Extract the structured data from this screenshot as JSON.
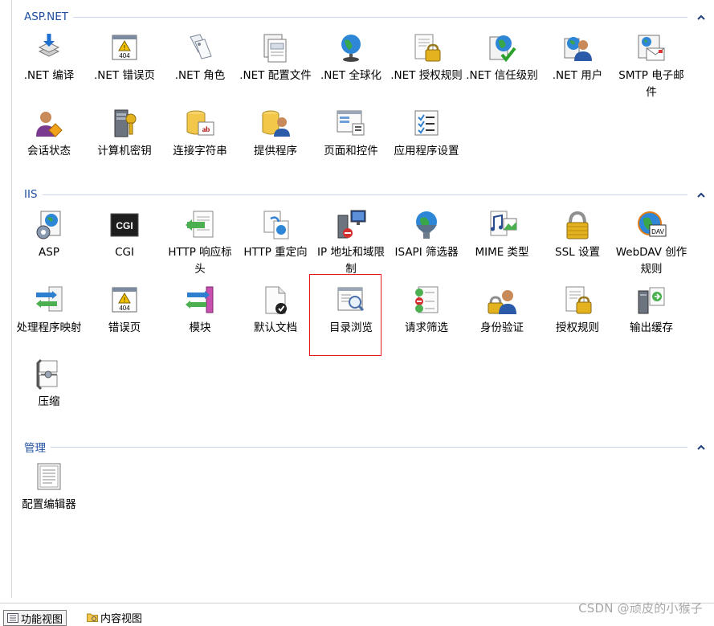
{
  "groups": [
    {
      "title": "ASP.NET",
      "features": [
        {
          "label": ".NET 编译",
          "icon": "dotnet-compilation-icon"
        },
        {
          "label": ".NET 错误页",
          "icon": "dotnet-error-pages-icon"
        },
        {
          "label": ".NET 角色",
          "icon": "dotnet-roles-icon"
        },
        {
          "label": ".NET 配置文件",
          "icon": "dotnet-profile-icon"
        },
        {
          "label": ".NET 全球化",
          "icon": "dotnet-globalization-icon"
        },
        {
          "label": ".NET 授权规则",
          "icon": "dotnet-authorization-rules-icon"
        },
        {
          "label": ".NET 信任级别",
          "icon": "dotnet-trust-levels-icon"
        },
        {
          "label": ".NET 用户",
          "icon": "dotnet-users-icon"
        },
        {
          "label": "SMTP 电子邮件",
          "icon": "smtp-email-icon"
        },
        {
          "label": "会话状态",
          "icon": "session-state-icon"
        },
        {
          "label": "计算机密钥",
          "icon": "machine-key-icon"
        },
        {
          "label": "连接字符串",
          "icon": "connection-strings-icon"
        },
        {
          "label": "提供程序",
          "icon": "providers-icon"
        },
        {
          "label": "页面和控件",
          "icon": "pages-controls-icon"
        },
        {
          "label": "应用程序设置",
          "icon": "application-settings-icon"
        }
      ]
    },
    {
      "title": "IIS",
      "features": [
        {
          "label": "ASP",
          "icon": "asp-icon"
        },
        {
          "label": "CGI",
          "icon": "cgi-icon"
        },
        {
          "label": "HTTP 响应标头",
          "icon": "http-response-headers-icon"
        },
        {
          "label": "HTTP 重定向",
          "icon": "http-redirect-icon"
        },
        {
          "label": "IP 地址和域限制",
          "icon": "ip-domain-restrictions-icon"
        },
        {
          "label": "ISAPI 筛选器",
          "icon": "isapi-filters-icon"
        },
        {
          "label": "MIME 类型",
          "icon": "mime-types-icon"
        },
        {
          "label": "SSL 设置",
          "icon": "ssl-settings-icon"
        },
        {
          "label": "WebDAV 创作规则",
          "icon": "webdav-authoring-rules-icon"
        },
        {
          "label": "处理程序映射",
          "icon": "handler-mappings-icon"
        },
        {
          "label": "错误页",
          "icon": "error-pages-icon"
        },
        {
          "label": "模块",
          "icon": "modules-icon"
        },
        {
          "label": "默认文档",
          "icon": "default-document-icon"
        },
        {
          "label": "目录浏览",
          "icon": "directory-browsing-icon"
        },
        {
          "label": "请求筛选",
          "icon": "request-filtering-icon"
        },
        {
          "label": "身份验证",
          "icon": "authentication-icon"
        },
        {
          "label": "授权规则",
          "icon": "authorization-rules-icon"
        },
        {
          "label": "输出缓存",
          "icon": "output-caching-icon"
        },
        {
          "label": "压缩",
          "icon": "compression-icon"
        }
      ]
    },
    {
      "title": "管理",
      "features": [
        {
          "label": "配置编辑器",
          "icon": "configuration-editor-icon"
        }
      ]
    }
  ],
  "collapse_glyph": "^",
  "statusbar": {
    "features_view_label": "功能视图",
    "content_view_label": "内容视图"
  },
  "watermark": "CSDN @顽皮的小猴子",
  "colors": {
    "group_title": "#1f4e9e",
    "group_line": "#c8d4ec",
    "highlight": "#e0191c"
  }
}
